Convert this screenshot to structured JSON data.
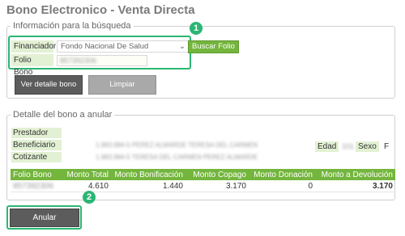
{
  "page": {
    "title": "Bono Electronico - Venta Directa"
  },
  "search": {
    "legend": "Información para la búsqueda",
    "financiador_label": "Financiador",
    "financiador_value": "Fondo Nacional De Salud",
    "folio_label": "Folio Bono",
    "folio_value": "857392306",
    "buscar_label": "Buscar Folio",
    "ver_detalle_label": "Ver detalle bono",
    "limpiar_label": "Limpiar"
  },
  "detail": {
    "legend": "Detalle del bono a anular",
    "prestador_label": "Prestador",
    "beneficiario_label": "Beneficiario",
    "beneficiario_value": "1.983.984-5 PEREZ ALMARDE TERESA DEL CARMEN",
    "cotizante_label": "Cotizante",
    "cotizante_value": "1.983.984-5 TERESA DEL CARMEN PEREZ ALMARDE",
    "edad_label": "Edad",
    "edad_value": "101",
    "sexo_label": "Sexo",
    "sexo_value": "F"
  },
  "table": {
    "headers": [
      "Folio Bono",
      "Monto Total",
      "Monto Bonificación",
      "Monto Copago",
      "Monto Donación",
      "Monto a Devolución"
    ],
    "rows": [
      {
        "folio": "857392306",
        "total": "4.610",
        "bonificacion": "1.440",
        "copago": "3.170",
        "donacion": "0",
        "devolucion": "3.170"
      }
    ]
  },
  "actions": {
    "anular_label": "Anular"
  },
  "badges": {
    "one": "1",
    "two": "2"
  },
  "colors": {
    "accent_green": "#74b53d",
    "highlight": "#2bb673",
    "dark_button": "#5c5c5c"
  }
}
